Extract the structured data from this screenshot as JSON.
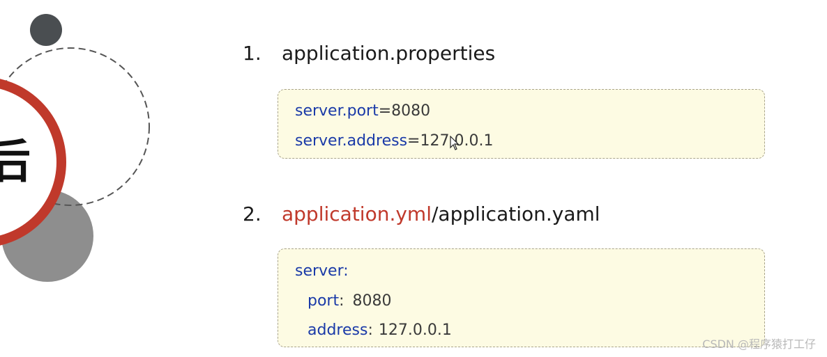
{
  "slide": {
    "side_title_fragment": "后",
    "items": [
      {
        "number": "1.",
        "title_plain": "application.properties",
        "code_lines": [
          {
            "key": "server.port",
            "sep": "=",
            "value": "8080"
          },
          {
            "key": "server.address",
            "sep": "=",
            "value": "127.0.0.1"
          }
        ]
      },
      {
        "number": "2.",
        "title_highlight": "application.yml",
        "title_rest": "/application.yaml",
        "code_lines": [
          {
            "key": "server",
            "sep": ":",
            "value": ""
          },
          {
            "key": "port",
            "sep": ":",
            "value": "8080"
          },
          {
            "key": "address",
            "sep": ":",
            "value": "127.0.0.1"
          }
        ]
      }
    ]
  },
  "watermark": "CSDN @程序猿打工仔",
  "colors": {
    "highlight": "#c0392b",
    "key": "#1a3aa8",
    "code_bg": "#fdfbe3",
    "ring": "#c0392b"
  }
}
